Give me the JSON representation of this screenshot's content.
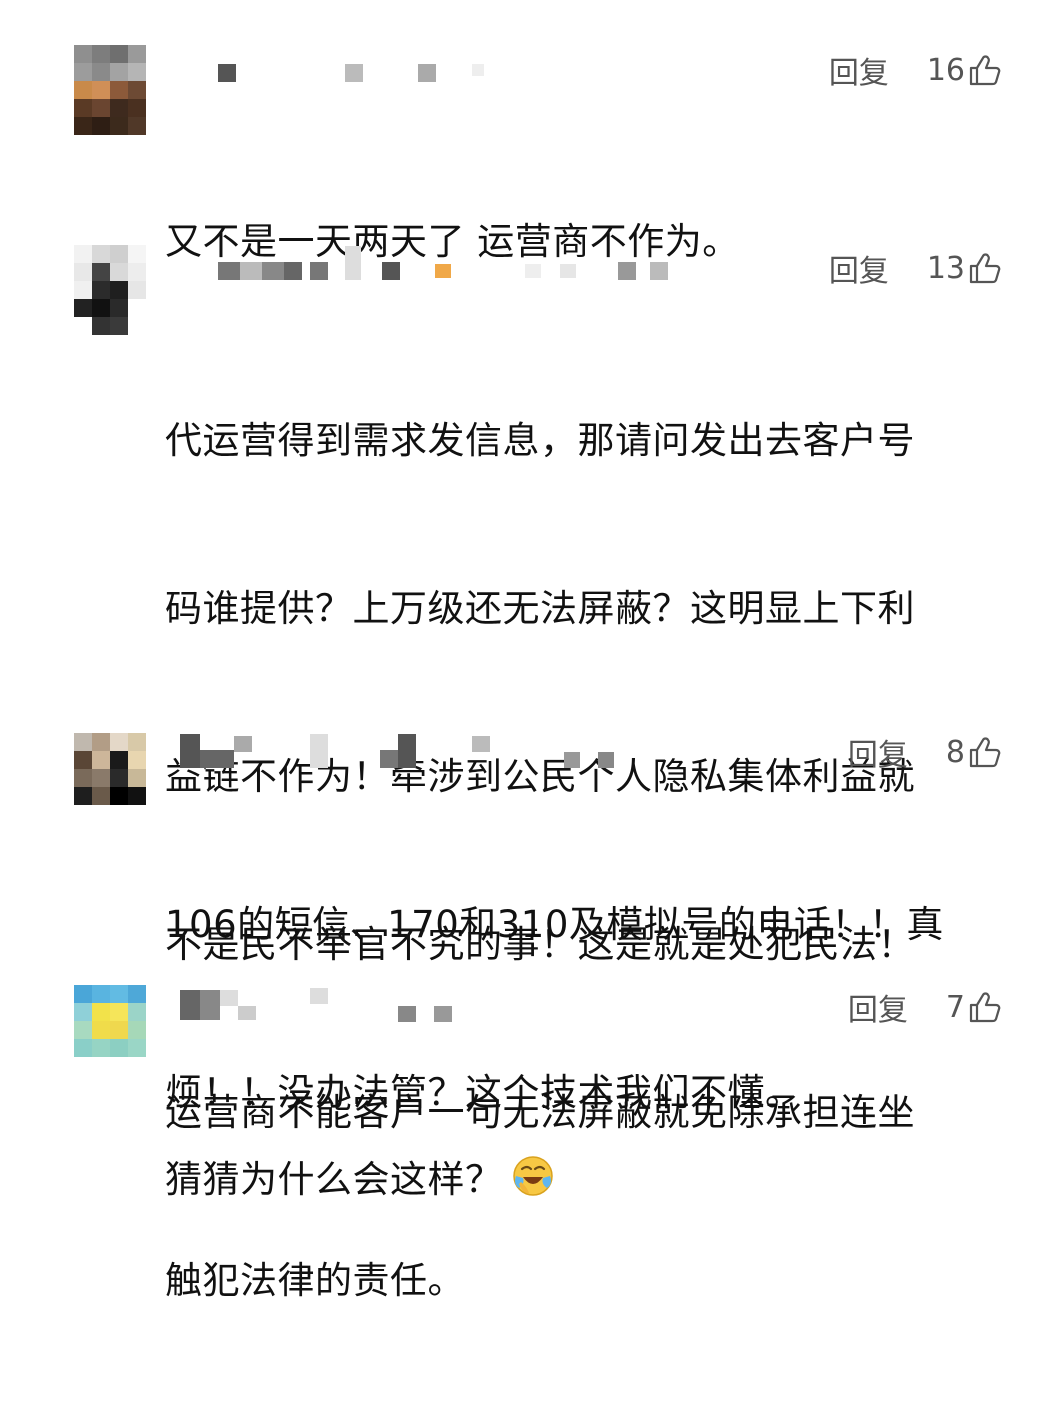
{
  "comments": [
    {
      "reply_label": "回复",
      "likes": "16",
      "lines": [
        "又不是一天两天了 运营商不作为。"
      ]
    },
    {
      "reply_label": "回复",
      "likes": "13",
      "lines": [
        "代运营得到需求发信息，那请问发出去客户号",
        "码谁提供？上万级还无法屏蔽？这明显上下利",
        "益链不作为！牵涉到公民个人隐私集体利益就",
        "不是民不举官不究的事！这是就是处犯民法！",
        "运营商不能客户一句无法屏蔽就免除承担连坐",
        "触犯法律的责任。"
      ]
    },
    {
      "reply_label": "回复",
      "likes": "8",
      "lines": [
        "106的短信、170和310及模拟号的电话！！真",
        "烦！！没办法管？这个技术我们不懂。"
      ]
    },
    {
      "reply_label": "回复",
      "likes": "7",
      "lines": [
        "猜猜为什么会这样？"
      ],
      "trailing_emoji": "face-with-tears-of-joy-icon"
    }
  ],
  "icons": {
    "like": "thumbs-up-outline-icon",
    "avatar": "pixelated-avatar",
    "username": "pixelated-username"
  },
  "colors": {
    "text": "#111111",
    "meta": "#555555",
    "background": "#ffffff"
  }
}
